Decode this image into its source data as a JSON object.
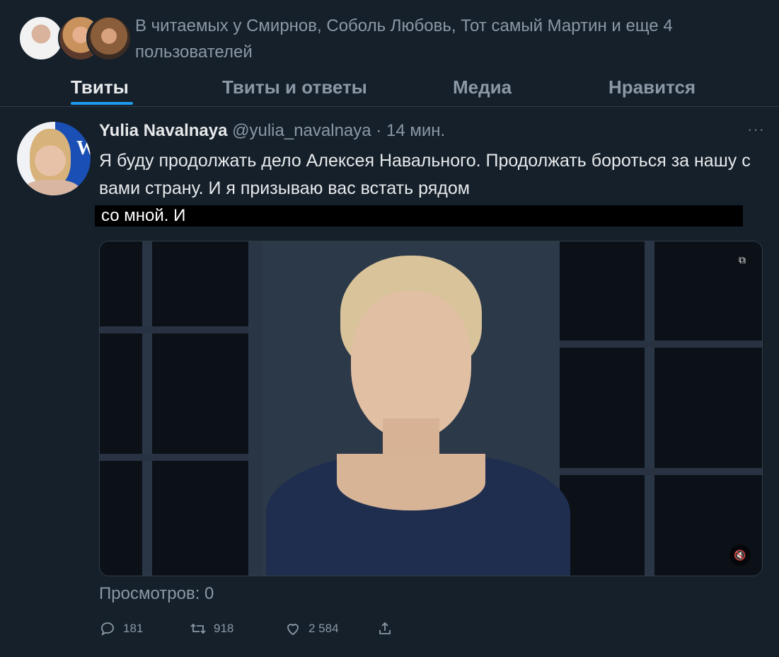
{
  "followers": {
    "text": "В читаемых у Смирнов, Соболь Любовь, Тот самый Мартин и еще 4 пользователей"
  },
  "tabs": [
    {
      "label": "Твиты",
      "active": true
    },
    {
      "label": "Твиты и ответы",
      "active": false
    },
    {
      "label": "Медиа",
      "active": false
    },
    {
      "label": "Нравится",
      "active": false
    }
  ],
  "tweet": {
    "name": "Yulia Navalnaya",
    "handle": "@yulia_navalnaya",
    "dot": "·",
    "time": "14 мин.",
    "more": "···",
    "text": "Я буду продолжать дело Алексея Навального. Продолжать бороться за нашу с вами страну. И я призываю вас встать рядом",
    "redacted_text": "со мной. И",
    "views": "Просмотров: 0",
    "counts": {
      "replies": "181",
      "retweets": "918",
      "likes": "2 584"
    }
  },
  "colors": {
    "background": "#15202b",
    "accent": "#1d9bf0",
    "secondary_text": "#8b98a5",
    "primary_text": "#e7e9ea"
  },
  "icons": {
    "more": "more-horizontal-icon",
    "reply": "reply-icon",
    "retweet": "retweet-icon",
    "like": "heart-icon",
    "share": "share-icon",
    "mute": "volume-muted-icon",
    "media_settings": "media-settings-icon"
  }
}
